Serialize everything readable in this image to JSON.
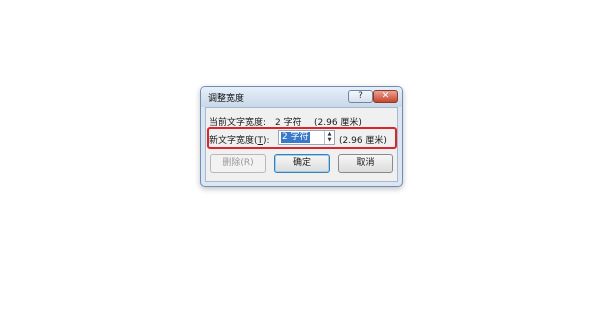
{
  "dialog": {
    "title": "调整宽度",
    "help_label": "?",
    "close_label": "✕",
    "current": {
      "label": "当前文字宽度:",
      "value": "2 字符",
      "cm": "(2.96 厘米)"
    },
    "new": {
      "label_prefix": "新文字宽度(",
      "label_key": "T",
      "label_suffix": "):",
      "input_value": "2 字符",
      "cm": "(2.96 厘米)"
    },
    "buttons": {
      "delete": "删除(R)",
      "ok": "确定",
      "cancel": "取消"
    },
    "colors": {
      "highlight": "#d9262e",
      "selection": "#3a78c9"
    }
  }
}
